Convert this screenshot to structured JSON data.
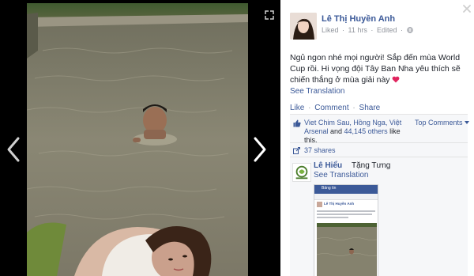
{
  "viewer": {
    "prev_icon": "chevron-left-icon",
    "next_icon": "chevron-right-icon",
    "expand_icon": "expand-icon",
    "close_icon": "close-icon"
  },
  "post": {
    "author": "Lê Thị Huyền Anh",
    "meta_liked": "Liked",
    "meta_sep1": "·",
    "meta_time": "11 hrs",
    "meta_sep2": "·",
    "meta_edited": "Edited",
    "meta_sep3": "·",
    "text": "Ngủ ngon nhé mọi người! Sắp đến mùa World Cup rồi. Hi vọng đội Tây Ban Nha yêu thích sẽ chiến thắng ở mùa giải này",
    "see_translation": "See Translation"
  },
  "actions": {
    "like": "Like",
    "sep1": "·",
    "comment": "Comment",
    "sep2": "·",
    "share": "Share"
  },
  "likes": {
    "names": "Viet Chim Sau, Hồng Nga, Việt Arsenal",
    "and": " and ",
    "others": "44,145 others",
    "suffix": " like this.",
    "top_comments": "Top Comments"
  },
  "shares": {
    "count": "37 shares"
  },
  "comment": {
    "author": "Lê Hiểu",
    "text": "Tặng Tưng",
    "see_translation": "See Translation"
  },
  "attached_screenshot": {
    "app_label": "Bảng tin",
    "post_author": "Lê Thị Huyền Anh"
  },
  "colors": {
    "link": "#3b5998",
    "text": "#1d2129",
    "meta": "#90949c",
    "heart": "#e0245e"
  }
}
